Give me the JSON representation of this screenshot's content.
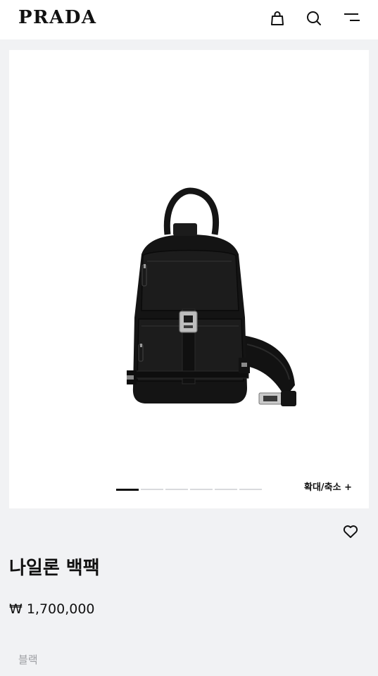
{
  "header": {
    "logo": "PRADA",
    "icons": [
      "bag-icon",
      "search-icon",
      "menu-icon"
    ]
  },
  "gallery": {
    "image_alt_name": "nylon-backpack-image",
    "slide_count": 6,
    "active_slide": 1,
    "zoom_label": "확대/축소 +"
  },
  "product": {
    "title": "나일론 백팩",
    "price": "₩ 1,700,000",
    "color": "블랙"
  },
  "colors": {
    "page_background": "#f1f2f4",
    "text": "#111111",
    "muted": "#9a9ca0"
  }
}
